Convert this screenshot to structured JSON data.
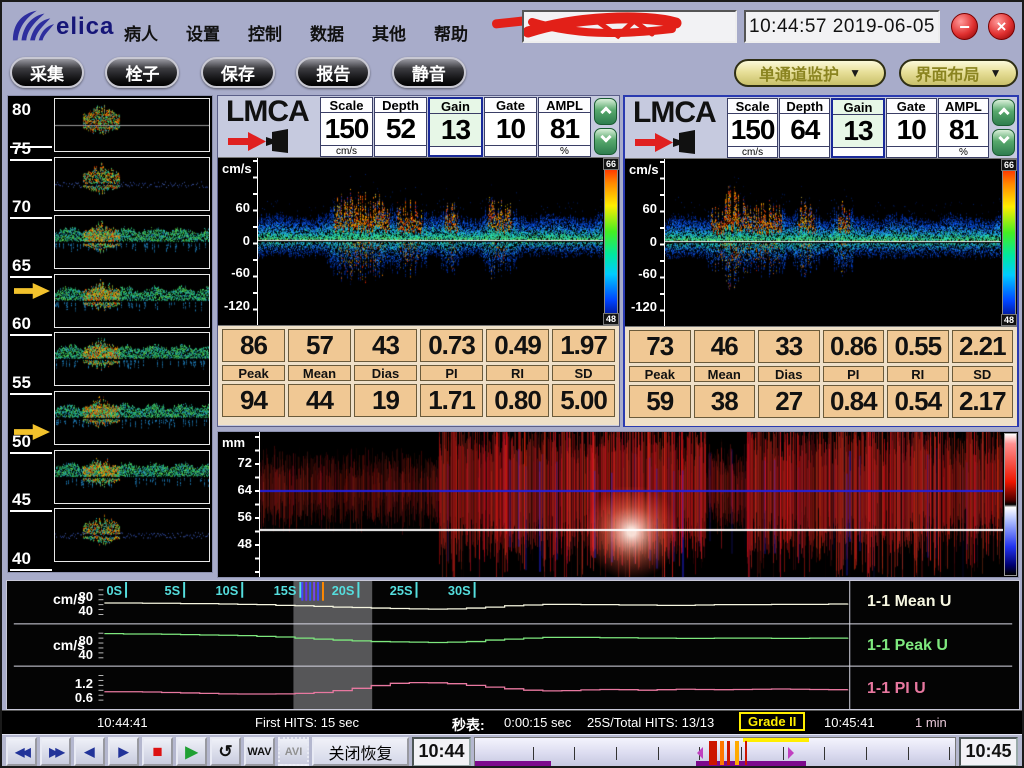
{
  "window": {
    "clock": "10:44:57 2019-06-05",
    "minimize_glyph": "−",
    "close_glyph": "×",
    "logo_text": "elica"
  },
  "menu": {
    "items": [
      "病人",
      "设置",
      "控制",
      "数据",
      "其他",
      "帮助"
    ]
  },
  "toolbar": {
    "buttons": [
      "采集",
      "栓子",
      "保存",
      "报告",
      "静音"
    ],
    "mode_dropdown": "单通道监护",
    "layout_dropdown": "界面布局",
    "dropdown_arrow": "▼"
  },
  "depth_scale": {
    "labels": [
      "80",
      "75",
      "70",
      "65",
      "60",
      "55",
      "50",
      "45",
      "40"
    ]
  },
  "channels": [
    {
      "name": "LMCA",
      "params": {
        "labels": [
          "Scale",
          "Depth",
          "Gain",
          "Gate",
          "AMPL"
        ],
        "values": [
          "150",
          "52",
          "13",
          "10",
          "81"
        ],
        "unit_scale": "cm/s",
        "unit_ampl": "%"
      },
      "spectrum": {
        "axis_unit": "cm/s",
        "ticks": [
          "60",
          "0",
          "-60",
          "-120"
        ],
        "colorbar_top": "66",
        "colorbar_bottom": "48"
      },
      "table": {
        "headers": [
          "Peak",
          "Mean",
          "Dias",
          "PI",
          "RI",
          "SD"
        ],
        "row_top": [
          "86",
          "57",
          "43",
          "0.73",
          "0.49",
          "1.97"
        ],
        "row_bottom": [
          "94",
          "44",
          "19",
          "1.71",
          "0.80",
          "5.00"
        ]
      }
    },
    {
      "name": "LMCA",
      "params": {
        "labels": [
          "Scale",
          "Depth",
          "Gain",
          "Gate",
          "AMPL"
        ],
        "values": [
          "150",
          "64",
          "13",
          "10",
          "81"
        ],
        "unit_scale": "cm/s",
        "unit_ampl": "%"
      },
      "spectrum": {
        "axis_unit": "cm/s",
        "ticks": [
          "60",
          "0",
          "-60",
          "-120"
        ],
        "colorbar_top": "66",
        "colorbar_bottom": "48"
      },
      "table": {
        "headers": [
          "Peak",
          "Mean",
          "Dias",
          "PI",
          "RI",
          "SD"
        ],
        "row_top": [
          "73",
          "46",
          "33",
          "0.86",
          "0.55",
          "2.21"
        ],
        "row_bottom": [
          "59",
          "38",
          "27",
          "0.84",
          "0.54",
          "2.17"
        ]
      }
    }
  ],
  "mmode": {
    "axis_unit": "mm",
    "ticks": [
      "72",
      "64",
      "56",
      "48"
    ],
    "blue_line_depth": 64,
    "white_line_depth": 52
  },
  "trend": {
    "time_labels": [
      "0S",
      "5S",
      "10S",
      "15S",
      "20S",
      "25S",
      "30S"
    ],
    "rows": [
      {
        "axis_unit": "cm/s",
        "tick_hi": "80",
        "tick_lo": "40",
        "legend": "1-1 Mean U",
        "color": "#f6f6e0",
        "series": [
          62,
          62,
          61,
          61,
          60,
          60,
          59,
          58,
          57,
          55,
          54,
          52,
          50,
          49,
          47,
          46,
          45,
          44,
          45,
          47,
          50,
          54,
          56,
          58,
          58,
          57,
          57,
          56,
          56,
          55,
          55,
          56,
          57,
          57,
          57,
          58,
          58,
          58,
          59,
          60
        ]
      },
      {
        "axis_unit": "cm/s",
        "tick_hi": "80",
        "tick_lo": "40",
        "legend": "1-1 Peak U",
        "color": "#7ee87e",
        "series": [
          96,
          95,
          95,
          94,
          93,
          92,
          91,
          90,
          88,
          86,
          83,
          80,
          77,
          75,
          73,
          72,
          71,
          70,
          71,
          73,
          77,
          80,
          83,
          85,
          85,
          85,
          84,
          84,
          83,
          83,
          82,
          82,
          83,
          83,
          83,
          82,
          82,
          83,
          83,
          84
        ]
      },
      {
        "axis_unit": "",
        "tick_hi": "1.2",
        "tick_lo": "0.6",
        "legend": "1-1 PI U",
        "color": "#e878a0",
        "series": [
          0.75,
          0.75,
          0.74,
          0.72,
          0.7,
          0.68,
          0.66,
          0.65,
          0.65,
          0.66,
          0.68,
          0.72,
          0.8,
          0.9,
          1.02,
          1.12,
          1.15,
          1.14,
          1.1,
          1.03,
          0.95,
          0.88,
          0.82,
          0.79,
          0.8,
          0.83,
          0.85,
          0.84,
          0.82,
          0.84,
          0.86,
          0.85,
          0.84,
          0.85,
          0.86,
          0.87,
          0.86,
          0.85,
          0.84,
          0.85
        ]
      }
    ],
    "hits_markers_x": [
      293,
      297,
      301,
      305,
      309,
      314
    ],
    "gray_region_x": [
      284,
      364
    ]
  },
  "status_bar": {
    "time_start": "10:44:41",
    "first_hits": "First HITS: 15 sec",
    "stopwatch_label": "秒表:",
    "stopwatch_value": "0:00:15 sec",
    "hits_total": "25S/Total HITS: 13/13",
    "grade": "Grade II",
    "time_end": "10:45:41",
    "window_length": "1 min"
  },
  "transport": {
    "rewind": "◀◀",
    "forward": "▶▶",
    "step_back": "◀",
    "step_fwd": "▶",
    "stop_glyph": "■",
    "play_glyph": "▶",
    "loop_glyph": "↺",
    "wav": "WAV",
    "avi": "AVI",
    "close_restore": "关闭恢复",
    "time_left": "10:44",
    "time_right": "10:45",
    "timeline": {
      "ticks_pct": [
        12,
        20.7,
        29.4,
        38.1,
        46.7,
        55.4,
        64.1,
        72.8,
        81.5,
        90.2,
        98.8
      ],
      "events": [
        {
          "x": 48.7,
          "w": 1.8,
          "c": "#cc1500"
        },
        {
          "x": 51.0,
          "w": 0.9,
          "c": "#ff7700"
        },
        {
          "x": 52.6,
          "w": 0.6,
          "c": "#cc1500"
        },
        {
          "x": 54.2,
          "w": 0.7,
          "c": "#ffaa00"
        },
        {
          "x": 56.2,
          "w": 0.5,
          "c": "#cc1500"
        }
      ],
      "in_marker_pct": 46.3,
      "out_marker_pct": 65.3,
      "progress_pct": [
        [
          0,
          15.8
        ],
        [
          46,
          69
        ]
      ],
      "selection_pct": [
        55.8,
        69.6
      ]
    }
  }
}
